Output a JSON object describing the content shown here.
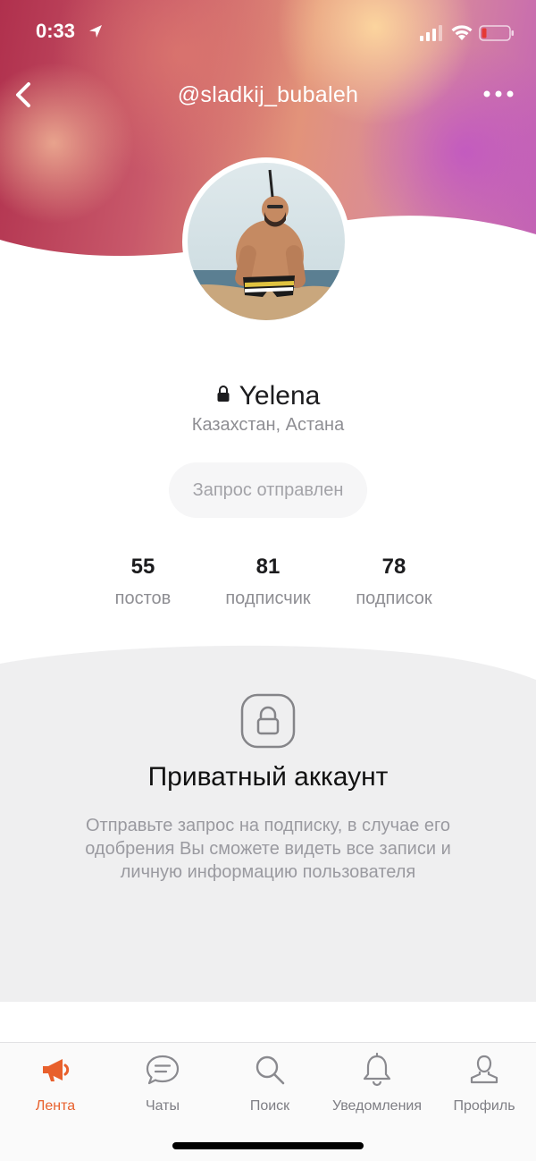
{
  "status_bar": {
    "time": "0:33",
    "battery_color": "#e53935"
  },
  "header": {
    "username": "@sladkij_bubaleh",
    "back_icon": "chevron-left-icon",
    "more_icon": "ellipsis-icon"
  },
  "profile": {
    "name": "Yelena",
    "location": "Казахстан, Астана",
    "request_button": "Запрос отправлен",
    "stats": [
      {
        "value": "55",
        "label": "постов"
      },
      {
        "value": "81",
        "label": "подписчик"
      },
      {
        "value": "78",
        "label": "подписок"
      }
    ]
  },
  "private_account": {
    "title": "Приватный аккаунт",
    "description": "Отправьте запрос на подписку, в случае его одобрения Вы сможете видеть все записи и личную информацию пользователя"
  },
  "tabbar": {
    "accent_color": "#e8602c",
    "items": [
      {
        "label": "Лента",
        "icon": "megaphone-icon",
        "active": true
      },
      {
        "label": "Чаты",
        "icon": "chat-bubble-icon",
        "active": false
      },
      {
        "label": "Поиск",
        "icon": "search-icon",
        "active": false
      },
      {
        "label": "Уведомления",
        "icon": "bell-icon",
        "active": false
      },
      {
        "label": "Профиль",
        "icon": "person-icon",
        "active": false
      }
    ]
  }
}
